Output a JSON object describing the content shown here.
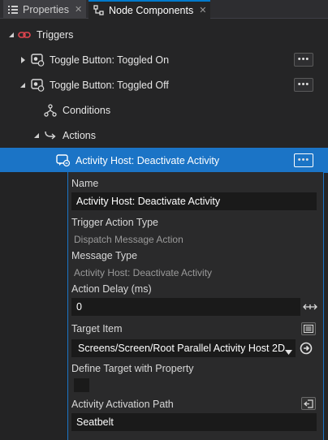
{
  "tabs": [
    {
      "label": "Properties",
      "icon": "list-icon",
      "close": "✕"
    },
    {
      "label": "Node Components",
      "icon": "node-components-icon",
      "close": "✕"
    }
  ],
  "tree": {
    "triggers": {
      "label": "Triggers"
    },
    "toggled_on": {
      "label": "Toggle Button: Toggled On",
      "more": "•••"
    },
    "toggled_off": {
      "label": "Toggle Button: Toggled Off",
      "more": "•••"
    },
    "conditions": {
      "label": "Conditions"
    },
    "actions": {
      "label": "Actions"
    },
    "selected_action": {
      "label": "Activity Host: Deactivate Activity",
      "more": "•••"
    }
  },
  "properties": {
    "name_label": "Name",
    "name_value": "Activity Host: Deactivate Activity",
    "trigger_action_type_label": "Trigger Action Type",
    "trigger_action_type_value": "Dispatch Message Action",
    "message_type_label": "Message Type",
    "message_type_value": "Activity Host: Deactivate Activity",
    "action_delay_label": "Action Delay (ms)",
    "action_delay_value": "0",
    "target_item_label": "Target Item",
    "target_item_value": "Screens/Screen/Root Parallel Activity Host 2D",
    "define_target_label": "Define Target with Property",
    "define_target_checked": false,
    "activation_path_label": "Activity Activation Path",
    "activation_path_value": "Seatbelt"
  },
  "colors": {
    "accent": "#007acc",
    "selection": "#1b74c6",
    "panel_bg": "#252526",
    "trigger_icon": "#e0454f"
  }
}
